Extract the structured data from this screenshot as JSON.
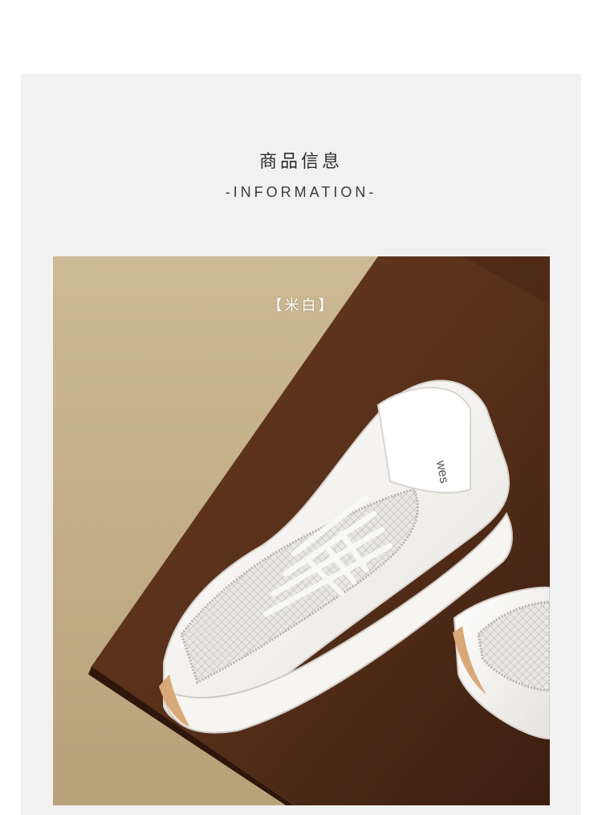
{
  "section": {
    "title_cn": "商品信息",
    "title_en": "-INFORMATION-"
  },
  "photo": {
    "color_label": "【米白】",
    "subject": "white-lace-sneaker",
    "tongue_text": "wes"
  },
  "colors": {
    "panel_bg": "#f1f1f1",
    "wall": "#c8b48e",
    "table": "#5a2e18",
    "shoe": "#f4f2ee",
    "sole_accent": "#d9a878"
  }
}
